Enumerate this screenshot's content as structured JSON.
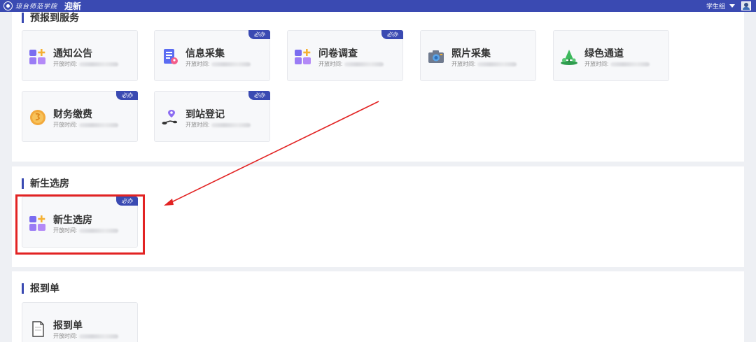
{
  "header": {
    "school_name": "琼台师范学院",
    "app_title": "迎新",
    "user_name": "学生组",
    "avatar_icon": "avatar-icon"
  },
  "sections": [
    {
      "title": "预报到服务",
      "cards": [
        {
          "name": "通知公告",
          "time_label": "开放时间:",
          "required": false,
          "icon": "blocks-plus-icon"
        },
        {
          "name": "信息采集",
          "time_label": "开放时间:",
          "required": true,
          "badge": "必办",
          "icon": "form-icon"
        },
        {
          "name": "问卷调查",
          "time_label": "开放时间:",
          "required": true,
          "badge": "必办",
          "icon": "blocks-plus-icon"
        },
        {
          "name": "照片采集",
          "time_label": "开放时间:",
          "required": false,
          "icon": "camera-icon"
        },
        {
          "name": "绿色通道",
          "time_label": "开放时间:",
          "required": false,
          "icon": "tree-icon"
        },
        {
          "name": "财务缴费",
          "time_label": "开放时间:",
          "required": true,
          "badge": "必办",
          "icon": "coin-icon"
        },
        {
          "name": "到站登记",
          "time_label": "开放时间:",
          "required": true,
          "badge": "必办",
          "icon": "location-route-icon"
        }
      ]
    },
    {
      "title": "新生选房",
      "cards": [
        {
          "name": "新生选房",
          "time_label": "开放时间:",
          "required": true,
          "badge": "必办",
          "icon": "blocks-plus-icon"
        }
      ]
    },
    {
      "title": "报到单",
      "cards": [
        {
          "name": "报到单",
          "time_label": "开放时间:",
          "required": false,
          "icon": "document-icon"
        }
      ]
    }
  ],
  "colors": {
    "primary": "#3a4ab2",
    "annotation": "#e22323",
    "card_bg": "#f7f8fa",
    "page_bg": "#eef0f4"
  }
}
